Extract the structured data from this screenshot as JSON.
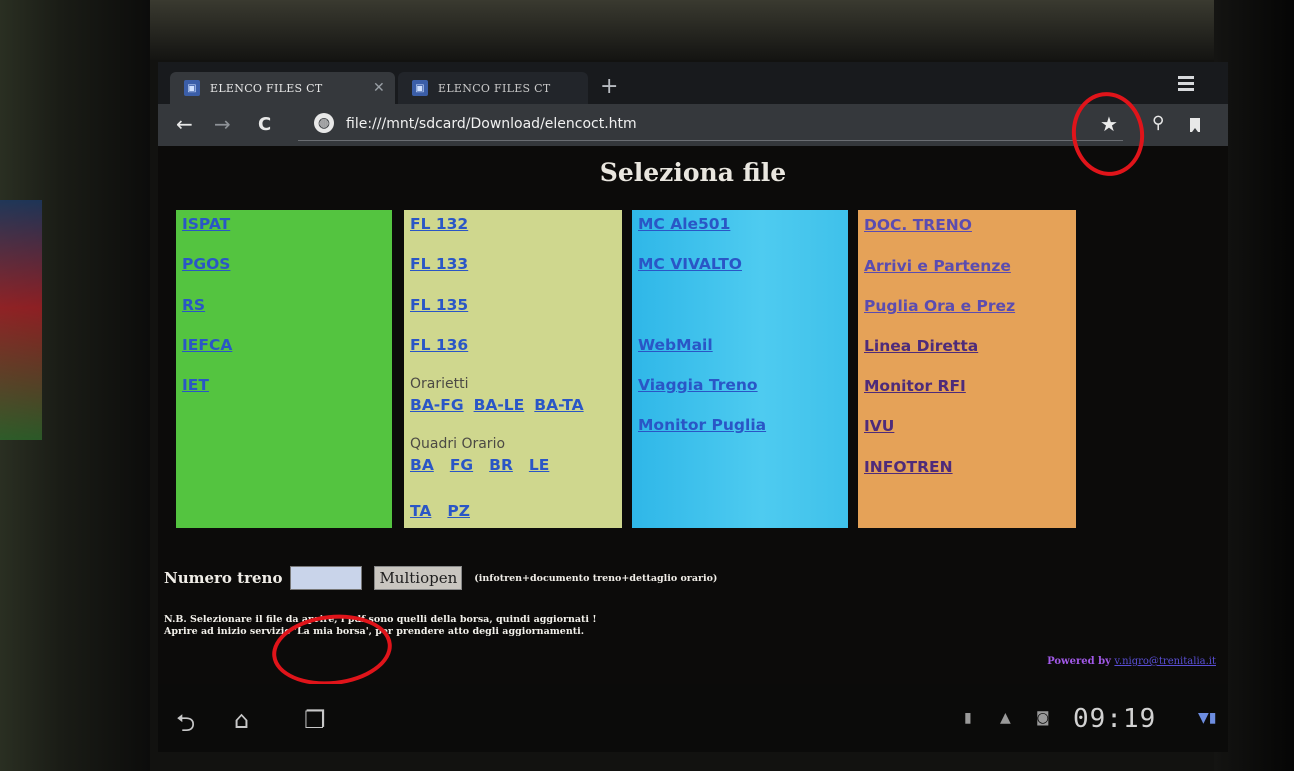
{
  "browser": {
    "tabs": [
      {
        "title": "ELENCO FILES CT",
        "active": true
      },
      {
        "title": "ELENCO FILES CT",
        "active": false
      }
    ],
    "url": "file:///mnt/sdcard/Download/elencoct.htm"
  },
  "page": {
    "title": "Seleziona file",
    "columns": {
      "green": {
        "links": [
          "ISPAT",
          "PGOS",
          "RS",
          "IEFCA",
          "IET"
        ]
      },
      "lime": {
        "links": [
          "FL 132",
          "FL 133",
          "FL 135",
          "FL 136"
        ],
        "orarietti_label": "Orarietti",
        "orarietti_links": [
          "BA-FG",
          "BA-LE",
          "BA-TA"
        ],
        "quadri_label": "Quadri Orario",
        "quadri_links": [
          "BA",
          "FG",
          "BR",
          "LE"
        ],
        "quadri_links_2": [
          "TA",
          "PZ"
        ]
      },
      "cyan": {
        "links": [
          "MC Ale501",
          "MC VIVALTO",
          "WebMail",
          "Viaggia Treno",
          "Monitor Puglia"
        ]
      },
      "orange": {
        "links": [
          "DOC. TRENO",
          "Arrivi e Partenze",
          "Puglia Ora e Prez",
          "Linea Diretta",
          "Monitor RFI",
          "IVU",
          "INFOTREN"
        ]
      }
    },
    "train_label": "Numero treno",
    "train_input_value": "",
    "multiopen_label": "Multiopen",
    "multiopen_note": "(infotren+documento treno+dettaglio orario)",
    "note_line1": "N.B. Selezionare il file da aprire, i pdf sono quelli della borsa, quindi aggiornati !",
    "note_line2": "Aprire ad inizio servizio 'La mia borsa', per prendere atto degli aggiornamenti.",
    "powered_by": "Powered by",
    "powered_email": "v.nigro@trenitalia.it"
  },
  "system_bar": {
    "clock": "09:19"
  },
  "colors": {
    "green": "#54c440",
    "lime": "#cfd78e",
    "cyan": "#3fc1ea",
    "orange": "#e5a258",
    "annotation": "#e0141a"
  }
}
